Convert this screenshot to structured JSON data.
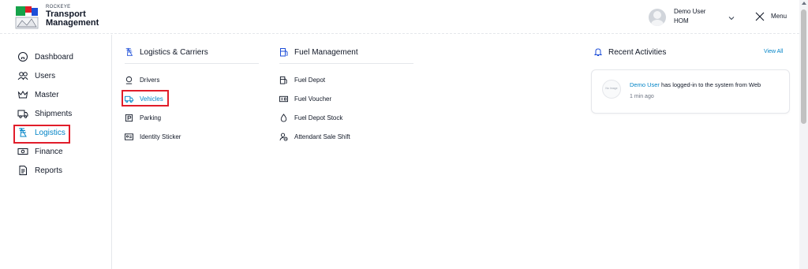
{
  "header": {
    "brand_small": "ROCKEYE",
    "brand_line1": "Transport",
    "brand_line2": "Management",
    "user_name": "Demo User",
    "user_org": "HOM",
    "menu_label": "Menu"
  },
  "sidebar": {
    "items": [
      {
        "label": "Dashboard",
        "icon": "home-icon"
      },
      {
        "label": "Users",
        "icon": "users-icon"
      },
      {
        "label": "Master",
        "icon": "crown-icon"
      },
      {
        "label": "Shipments",
        "icon": "truck-icon"
      },
      {
        "label": "Logistics",
        "icon": "logistics-icon"
      },
      {
        "label": "Finance",
        "icon": "cash-icon"
      },
      {
        "label": "Reports",
        "icon": "document-icon"
      }
    ],
    "active": "Logistics"
  },
  "logistics": {
    "title": "Logistics & Carriers",
    "items": [
      {
        "label": "Drivers",
        "icon": "driver-icon"
      },
      {
        "label": "Vehicles",
        "icon": "truck-icon"
      },
      {
        "label": "Parking",
        "icon": "parking-icon"
      },
      {
        "label": "Identity Sticker",
        "icon": "id-card-icon"
      }
    ],
    "active": "Vehicles"
  },
  "fuel": {
    "title": "Fuel Management",
    "items": [
      {
        "label": "Fuel Depot",
        "icon": "fuel-pump-icon"
      },
      {
        "label": "Fuel Voucher",
        "icon": "voucher-icon"
      },
      {
        "label": "Fuel Depot Stock",
        "icon": "drop-icon"
      },
      {
        "label": "Attendant Sale Shift",
        "icon": "attendant-icon"
      }
    ]
  },
  "activities": {
    "title": "Recent Activities",
    "view_all": "View All",
    "items": [
      {
        "avatar_text": "No Image",
        "user": "Demo User",
        "text": " has logged-in to the system from Web",
        "time": "1 min ago"
      }
    ]
  },
  "colors": {
    "accent": "#0284c7",
    "highlight": "#e11d2a"
  }
}
